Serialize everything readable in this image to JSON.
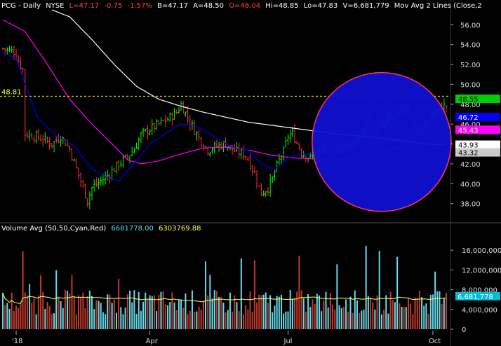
{
  "header": {
    "symbol": "PCG - Daily",
    "exchange": "NYSE",
    "last": "L=47.17",
    "change": "-0.75",
    "change_pct": "-1.57%",
    "bid": "B=47.17",
    "ask": "A=48.50",
    "open": "O=48.04",
    "high": "Hi=48.85",
    "low": "Lo=47.83",
    "volume": "V=6,681,779",
    "indicator": "Mov Avg 2 Lines (Close,2"
  },
  "volume_header": {
    "label": "Volume Avg (50,50,Cyan,Red)",
    "value1": "6681778.00",
    "value2": "6303769.88"
  },
  "colors": {
    "up": "#00ff00",
    "down": "#ff3333",
    "ma_short": "#0000ff",
    "ma_mid": "#ff00ff",
    "ma_long": "#ffffff",
    "vol_up": "#66d9e8",
    "vol_down": "#c0392b",
    "vol_avg": "#ffff66",
    "resistance": "#ffff00"
  },
  "chart_data": {
    "type": "candlestick",
    "price_axis": {
      "ticks": [
        "56.00",
        "54.00",
        "52.00",
        "50.00",
        "48.00",
        "46.00",
        "44.00",
        "42.00",
        "40.00",
        "38.00"
      ],
      "range": [
        36.5,
        57.5
      ]
    },
    "volume_axis": {
      "ticks": [
        "16,000,000",
        "12,000,000",
        "8,000,000",
        "4,000,000",
        "0"
      ],
      "range": [
        0,
        19000000
      ]
    },
    "x_labels": [
      {
        "label": "'18",
        "index": 6
      },
      {
        "label": "Apr",
        "index": 66
      },
      {
        "label": "Jul",
        "index": 128
      },
      {
        "label": "Oct",
        "index": 193
      }
    ],
    "resistance_level": {
      "value": 48.81,
      "label": "48.81"
    },
    "price_tags": [
      {
        "label": "48.55",
        "value": 48.55,
        "bg": "#00cc00",
        "fg": "#000000"
      },
      {
        "label": "46.72",
        "value": 46.72,
        "bg": "#0000ff",
        "fg": "#ffffff"
      },
      {
        "label": "45.43",
        "value": 45.43,
        "bg": "#ff00ff",
        "fg": "#ffffff"
      },
      {
        "label": "43.93",
        "value": 43.93,
        "bg": "#ffffff",
        "fg": "#000000"
      },
      {
        "label": "43.32",
        "value": 43.32,
        "bg": "#cccccc",
        "fg": "#000000"
      }
    ],
    "volume_tag": {
      "label": "6,681,778"
    },
    "highlight_circle": {
      "center_index": 170,
      "center_price": 44.2,
      "radius_days": 12
    },
    "close_keypoints": [
      [
        0,
        53.6
      ],
      [
        5,
        53.3
      ],
      [
        9,
        51.5
      ],
      [
        10,
        45.0
      ],
      [
        14,
        44.8
      ],
      [
        18,
        44.5
      ],
      [
        22,
        44.0
      ],
      [
        26,
        44.8
      ],
      [
        30,
        43.5
      ],
      [
        33,
        41.5
      ],
      [
        36,
        39.6
      ],
      [
        38,
        38.3
      ],
      [
        40,
        39.6
      ],
      [
        44,
        40.3
      ],
      [
        48,
        41.0
      ],
      [
        52,
        42.0
      ],
      [
        56,
        42.7
      ],
      [
        59,
        43.5
      ],
      [
        62,
        44.9
      ],
      [
        66,
        45.5
      ],
      [
        70,
        46.0
      ],
      [
        74,
        46.5
      ],
      [
        78,
        47.2
      ],
      [
        80,
        48.0
      ],
      [
        84,
        46.2
      ],
      [
        88,
        44.6
      ],
      [
        92,
        43.4
      ],
      [
        96,
        43.8
      ],
      [
        100,
        44.0
      ],
      [
        104,
        43.3
      ],
      [
        108,
        43.0
      ],
      [
        110,
        42.5
      ],
      [
        113,
        41.0
      ],
      [
        116,
        39.0
      ],
      [
        119,
        39.6
      ],
      [
        121,
        40.5
      ],
      [
        124,
        42.4
      ],
      [
        126,
        43.2
      ],
      [
        128,
        44.8
      ],
      [
        130,
        45.0
      ],
      [
        134,
        43.2
      ],
      [
        138,
        42.6
      ],
      [
        142,
        43.3
      ],
      [
        146,
        43.8
      ],
      [
        150,
        43.6
      ],
      [
        154,
        44.0
      ],
      [
        158,
        43.8
      ],
      [
        162,
        45.2
      ],
      [
        164,
        47.0
      ],
      [
        166,
        46.2
      ],
      [
        168,
        45.4
      ],
      [
        170,
        45.6
      ],
      [
        174,
        46.6
      ],
      [
        178,
        46.9
      ],
      [
        181,
        47.8
      ],
      [
        184,
        46.2
      ],
      [
        187,
        45.2
      ],
      [
        190,
        46.2
      ],
      [
        193,
        47.0
      ],
      [
        196,
        47.6
      ],
      [
        198,
        47.8
      ]
    ],
    "ma_short_keypoints": [
      [
        0,
        53.2
      ],
      [
        6,
        52.6
      ],
      [
        10,
        50.0
      ],
      [
        16,
        46.5
      ],
      [
        24,
        44.8
      ],
      [
        32,
        43.8
      ],
      [
        40,
        41.5
      ],
      [
        48,
        40.5
      ],
      [
        52,
        40.3
      ],
      [
        58,
        41.8
      ],
      [
        66,
        44.0
      ],
      [
        74,
        45.2
      ],
      [
        80,
        46.0
      ],
      [
        86,
        45.9
      ],
      [
        92,
        45.1
      ],
      [
        98,
        44.3
      ],
      [
        104,
        43.6
      ],
      [
        110,
        43.4
      ],
      [
        116,
        42.0
      ],
      [
        122,
        41.4
      ],
      [
        128,
        42.6
      ],
      [
        134,
        43.0
      ],
      [
        140,
        43.0
      ],
      [
        148,
        43.2
      ],
      [
        156,
        43.3
      ],
      [
        164,
        43.9
      ],
      [
        172,
        45.0
      ],
      [
        180,
        46.0
      ],
      [
        188,
        46.2
      ],
      [
        198,
        46.7
      ]
    ],
    "ma_mid_keypoints": [
      [
        0,
        56.5
      ],
      [
        10,
        55.3
      ],
      [
        20,
        52.0
      ],
      [
        30,
        48.5
      ],
      [
        40,
        46.0
      ],
      [
        50,
        43.8
      ],
      [
        56,
        42.4
      ],
      [
        62,
        42.0
      ],
      [
        70,
        42.3
      ],
      [
        80,
        43.0
      ],
      [
        90,
        43.6
      ],
      [
        100,
        43.7
      ],
      [
        110,
        43.4
      ],
      [
        120,
        42.9
      ],
      [
        130,
        42.6
      ],
      [
        140,
        42.5
      ],
      [
        150,
        42.4
      ],
      [
        160,
        42.6
      ],
      [
        170,
        43.2
      ],
      [
        180,
        43.8
      ],
      [
        190,
        44.6
      ],
      [
        198,
        45.4
      ]
    ],
    "ma_long_keypoints": [
      [
        22,
        57.5
      ],
      [
        30,
        56.8
      ],
      [
        40,
        54.5
      ],
      [
        50,
        52.0
      ],
      [
        60,
        49.8
      ],
      [
        70,
        48.5
      ],
      [
        80,
        47.8
      ],
      [
        90,
        47.2
      ],
      [
        100,
        46.7
      ],
      [
        110,
        46.2
      ],
      [
        120,
        45.9
      ],
      [
        130,
        45.6
      ],
      [
        140,
        45.3
      ],
      [
        150,
        45.0
      ],
      [
        160,
        44.8
      ],
      [
        170,
        44.6
      ],
      [
        180,
        44.3
      ],
      [
        190,
        44.0
      ],
      [
        198,
        43.9
      ]
    ],
    "bars": 200
  }
}
